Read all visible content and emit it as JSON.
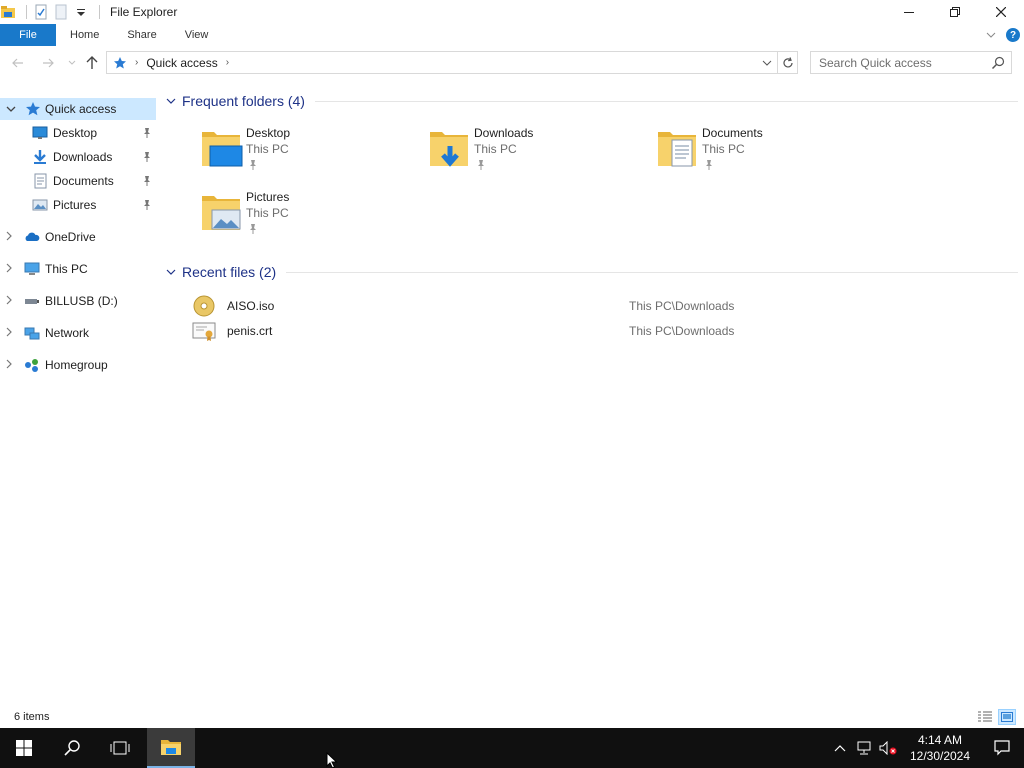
{
  "window": {
    "title": "File Explorer",
    "controls": [
      "minimize",
      "restore",
      "close"
    ]
  },
  "ribbon": {
    "tabs": [
      {
        "label": "File",
        "active": true
      },
      {
        "label": "Home"
      },
      {
        "label": "Share"
      },
      {
        "label": "View"
      }
    ]
  },
  "address": {
    "crumb": "Quick access",
    "search_placeholder": "Search Quick access"
  },
  "nav": {
    "items": [
      {
        "label": "Quick access",
        "icon": "star-icon",
        "selected": true,
        "expanded": true
      },
      {
        "label": "Desktop",
        "icon": "desktop-icon",
        "pinned": true
      },
      {
        "label": "Downloads",
        "icon": "downloads-icon",
        "pinned": true
      },
      {
        "label": "Documents",
        "icon": "documents-icon",
        "pinned": true
      },
      {
        "label": "Pictures",
        "icon": "pictures-icon",
        "pinned": true
      },
      {
        "label": "OneDrive",
        "icon": "onedrive-icon"
      },
      {
        "label": "This PC",
        "icon": "this-pc-icon"
      },
      {
        "label": "BILLUSB (D:)",
        "icon": "usb-drive-icon"
      },
      {
        "label": "Network",
        "icon": "network-icon"
      },
      {
        "label": "Homegroup",
        "icon": "homegroup-icon"
      }
    ]
  },
  "frequent": {
    "title": "Frequent folders (4)",
    "folders": [
      {
        "name": "Desktop",
        "location": "This PC",
        "icon": "folder-desktop-icon"
      },
      {
        "name": "Downloads",
        "location": "This PC",
        "icon": "folder-downloads-icon"
      },
      {
        "name": "Documents",
        "location": "This PC",
        "icon": "folder-documents-icon"
      },
      {
        "name": "Pictures",
        "location": "This PC",
        "icon": "folder-pictures-icon"
      }
    ]
  },
  "recent": {
    "title": "Recent files (2)",
    "files": [
      {
        "name": "AISO.iso",
        "path": "This PC\\Downloads",
        "icon": "disc-image-icon"
      },
      {
        "name": "penis.crt",
        "path": "This PC\\Downloads",
        "icon": "certificate-icon"
      }
    ]
  },
  "status": {
    "count": "6 items"
  },
  "taskbar": {
    "time": "4:14 AM",
    "date": "12/30/2024"
  },
  "colors": {
    "accent": "#1979ca",
    "selection": "#cce8ff",
    "group_header": "#1e3287",
    "taskbar": "#101010"
  }
}
